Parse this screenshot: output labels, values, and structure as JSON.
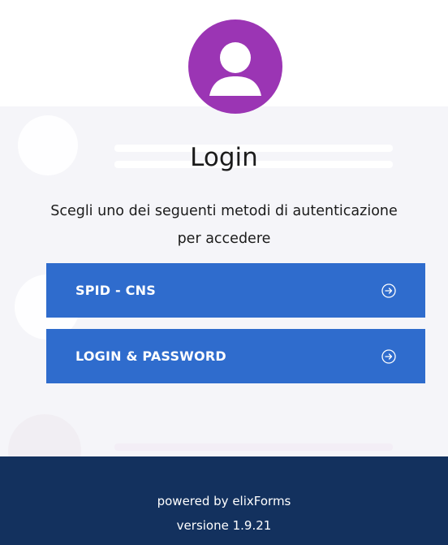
{
  "login": {
    "title": "Login",
    "subtitle": "Scegli uno dei seguenti metodi di autenticazione per accedere",
    "methods": [
      {
        "label": "SPID - CNS",
        "icon": "arrow-right-circle-icon"
      },
      {
        "label": "LOGIN & PASSWORD",
        "icon": "arrow-right-circle-icon"
      }
    ],
    "avatar_icon": "user-icon"
  },
  "footer": {
    "powered_by": "powered by elixForms",
    "version": "versione 1.9.21"
  },
  "colors": {
    "avatar": "#9b35b4",
    "button": "#2f6ccd",
    "footer": "#13315e"
  }
}
